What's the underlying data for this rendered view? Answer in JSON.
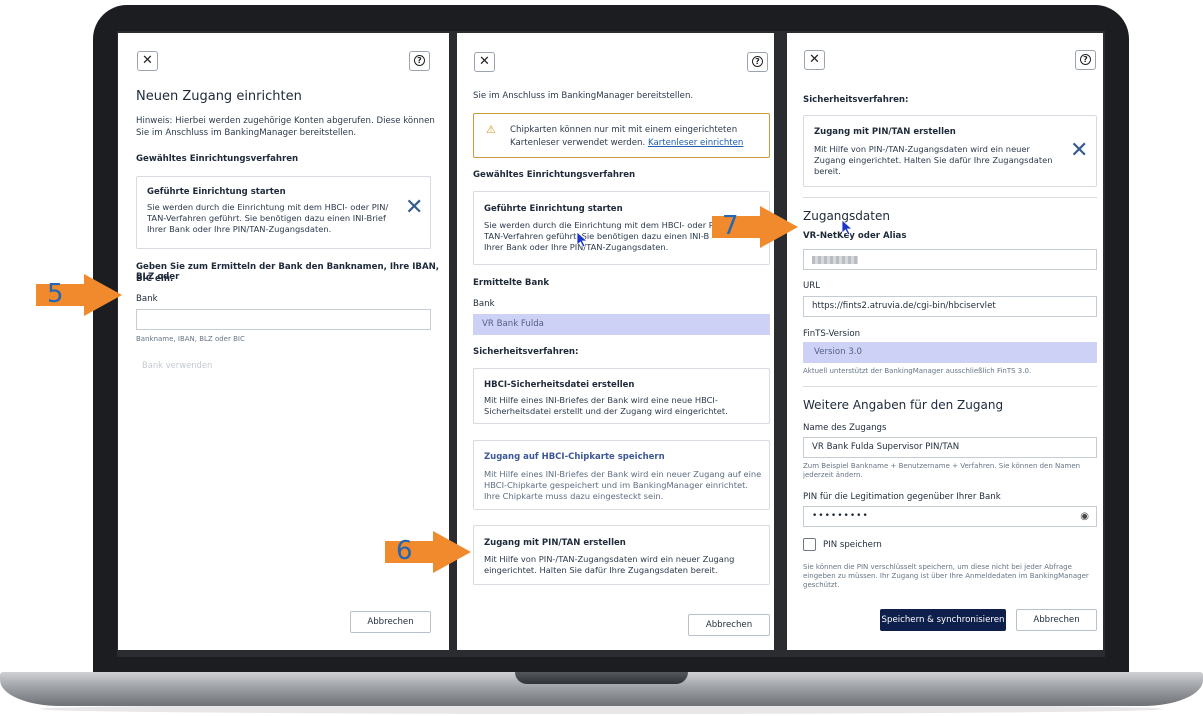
{
  "panel1": {
    "title": "Neuen Zugang einrichten",
    "hint_line1": "Hinweis: Hierbei werden zugehörige Konten abgerufen. Diese können",
    "hint_line2": "Sie im Anschluss im BankingManager bereitstellen.",
    "method_heading": "Gewähltes Einrichtungsverfahren",
    "card_title": "Geführte Einrichtung starten",
    "card_line1": "Sie werden durch die Einrichtung mit dem HBCI- oder PIN/",
    "card_line2": "TAN-Verfahren geführt. Sie benötigen dazu einen INI-Brief",
    "card_line3": "Ihrer Bank oder Ihre PIN/TAN-Zugangsdaten.",
    "prompt_line1": "Geben Sie zum Ermitteln der Bank den Banknamen, Ihre IBAN, BLZ oder",
    "prompt_line2": "BIC ein.",
    "bank_label": "Bank",
    "bank_value": "",
    "bank_hint": "Bankname, IBAN, BLZ oder BIC",
    "use_bank_button": "Bank verwenden",
    "cancel_button": "Abbrechen"
  },
  "panel2": {
    "top_text": "Sie im Anschluss im BankingManager bereitstellen.",
    "warn_line1": "Chipkarten können nur mit mit einem eingerichteten",
    "warn_line2_a": "Kartenleser verwendet werden.",
    "warn_link": "Kartenleser einrichten",
    "method_heading": "Gewähltes Einrichtungsverfahren",
    "card_title": "Geführte Einrichtung starten",
    "card_line1": "Sie werden durch die Einrichtung mit dem HBCI- oder P",
    "card_line2": "TAN-Verfahren geführt. Sie benötigen dazu einen INI-B",
    "card_line3": "Ihrer Bank oder Ihre PIN/TAN-Zugangsdaten.",
    "bank_heading": "Ermittelte Bank",
    "bank_label": "Bank",
    "bank_value": "VR Bank Fulda",
    "security_heading": "Sicherheitsverfahren:",
    "opt1_title": "HBCI-Sicherheitsdatei erstellen",
    "opt1_line1": "Mit Hilfe eines INI-Briefes der Bank wird eine neue HBCI-",
    "opt1_line2": "Sicherheitsdatei erstellt und der Zugang wird eingerichtet.",
    "opt2_title": "Zugang auf HBCI-Chipkarte speichern",
    "opt2_line1": "Mit Hilfe eines INI-Briefes der Bank wird ein neuer Zugang auf eine",
    "opt2_line2": "HBCI-Chipkarte gespeichert und im BankingManager einrichtet.",
    "opt2_line3": "Ihre Chipkarte muss dazu eingesteckt sein.",
    "opt3_title": "Zugang mit PIN/TAN erstellen",
    "opt3_line1": "Mit Hilfe von PIN-/TAN-Zugangsdaten wird ein neuer Zugang",
    "opt3_line2": "eingerichtet. Halten Sie dafür Ihre Zugangsdaten bereit.",
    "cancel_button": "Abbrechen"
  },
  "panel3": {
    "security_heading": "Sicherheitsverfahren:",
    "card_title": "Zugang mit PIN/TAN erstellen",
    "card_line1": "Mit Hilfe von PIN-/TAN-Zugangsdaten wird ein neuer",
    "card_line2": "Zugang eingerichtet. Halten Sie dafür Ihre Zugangsdaten",
    "card_line3": "bereit.",
    "access_heading": "Zugangsdaten",
    "netkey_label": "VR-NetKey oder Alias",
    "url_label": "URL",
    "url_value": "https://fints2.atruvia.de/cgi-bin/hbciservlet",
    "fints_label": "FinTS-Version",
    "fints_value": "Version 3.0",
    "fints_hint": "Aktuell unterstützt der BankingManager ausschließlich FinTS 3.0.",
    "more_heading": "Weitere Angaben für den Zugang",
    "name_label": "Name des Zugangs",
    "name_value": "VR Bank Fulda Supervisor PIN/TAN",
    "name_hint_line1": "Zum Beispiel Bankname + Benutzername + Verfahren. Sie können den Namen",
    "name_hint_line2": "jederzeit ändern.",
    "pin_label": "PIN für die Legitimation gegenüber Ihrer Bank",
    "pin_value": "•••••••••",
    "save_pin_label": "PIN speichern",
    "pin_hint_line1": "Sie können die PIN verschlüsselt speichern, um diese nicht bei jeder Abfrage",
    "pin_hint_line2": "eingeben zu müssen. Ihr Zugang ist über Ihre Anmeldedaten im BankingManager",
    "pin_hint_line3": "geschützt.",
    "save_button": "Speichern & synchronisieren",
    "cancel_button": "Abbrechen"
  },
  "steps": {
    "s5": "5",
    "s6": "6",
    "s7": "7"
  },
  "colors": {
    "arrow": "#f08a2c",
    "step": "#2366b3",
    "primary": "#0d1f4a",
    "highlight": "#cdd1f6"
  },
  "icons": [
    "close-icon",
    "help-icon",
    "x-icon",
    "warning-icon",
    "eye-icon",
    "cursor-icon"
  ]
}
